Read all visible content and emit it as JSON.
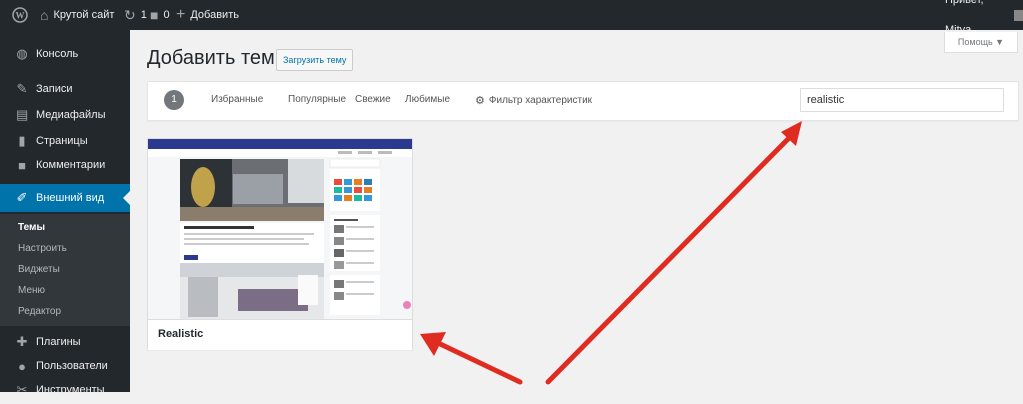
{
  "adminbar": {
    "site_name": "Крутой сайт",
    "updates_count": "1",
    "comments_count": "0",
    "add_label": "Добавить",
    "greeting": "Привет, Mitya"
  },
  "sidebar": {
    "items": [
      {
        "label": "Консоль",
        "icon": "dashboard-icon"
      },
      {
        "label": "Записи",
        "icon": "pin-icon"
      },
      {
        "label": "Медиафайлы",
        "icon": "media-icon"
      },
      {
        "label": "Страницы",
        "icon": "page-icon"
      },
      {
        "label": "Комментарии",
        "icon": "comment-icon"
      },
      {
        "label": "Внешний вид",
        "icon": "brush-icon"
      },
      {
        "label": "Плагины",
        "icon": "plugin-icon"
      },
      {
        "label": "Пользователи",
        "icon": "users-icon"
      },
      {
        "label": "Инструменты",
        "icon": "tools-icon"
      }
    ],
    "submenu": [
      "Темы",
      "Настроить",
      "Виджеты",
      "Меню",
      "Редактор"
    ]
  },
  "page": {
    "title": "Добавить темы",
    "upload_label": "Загрузить тему",
    "help_label": "Помощь ▼"
  },
  "filter": {
    "count": "1",
    "tabs": [
      "Избранные",
      "Популярные",
      "Свежие",
      "Любимые"
    ],
    "feature_filter": "Фильтр характеристик",
    "search_value": "realistic"
  },
  "theme": {
    "name": "Realistic"
  },
  "colors": {
    "adminbar": "#23282d",
    "active_menu": "#0073aa",
    "annotation_arrow": "#e02b20"
  }
}
